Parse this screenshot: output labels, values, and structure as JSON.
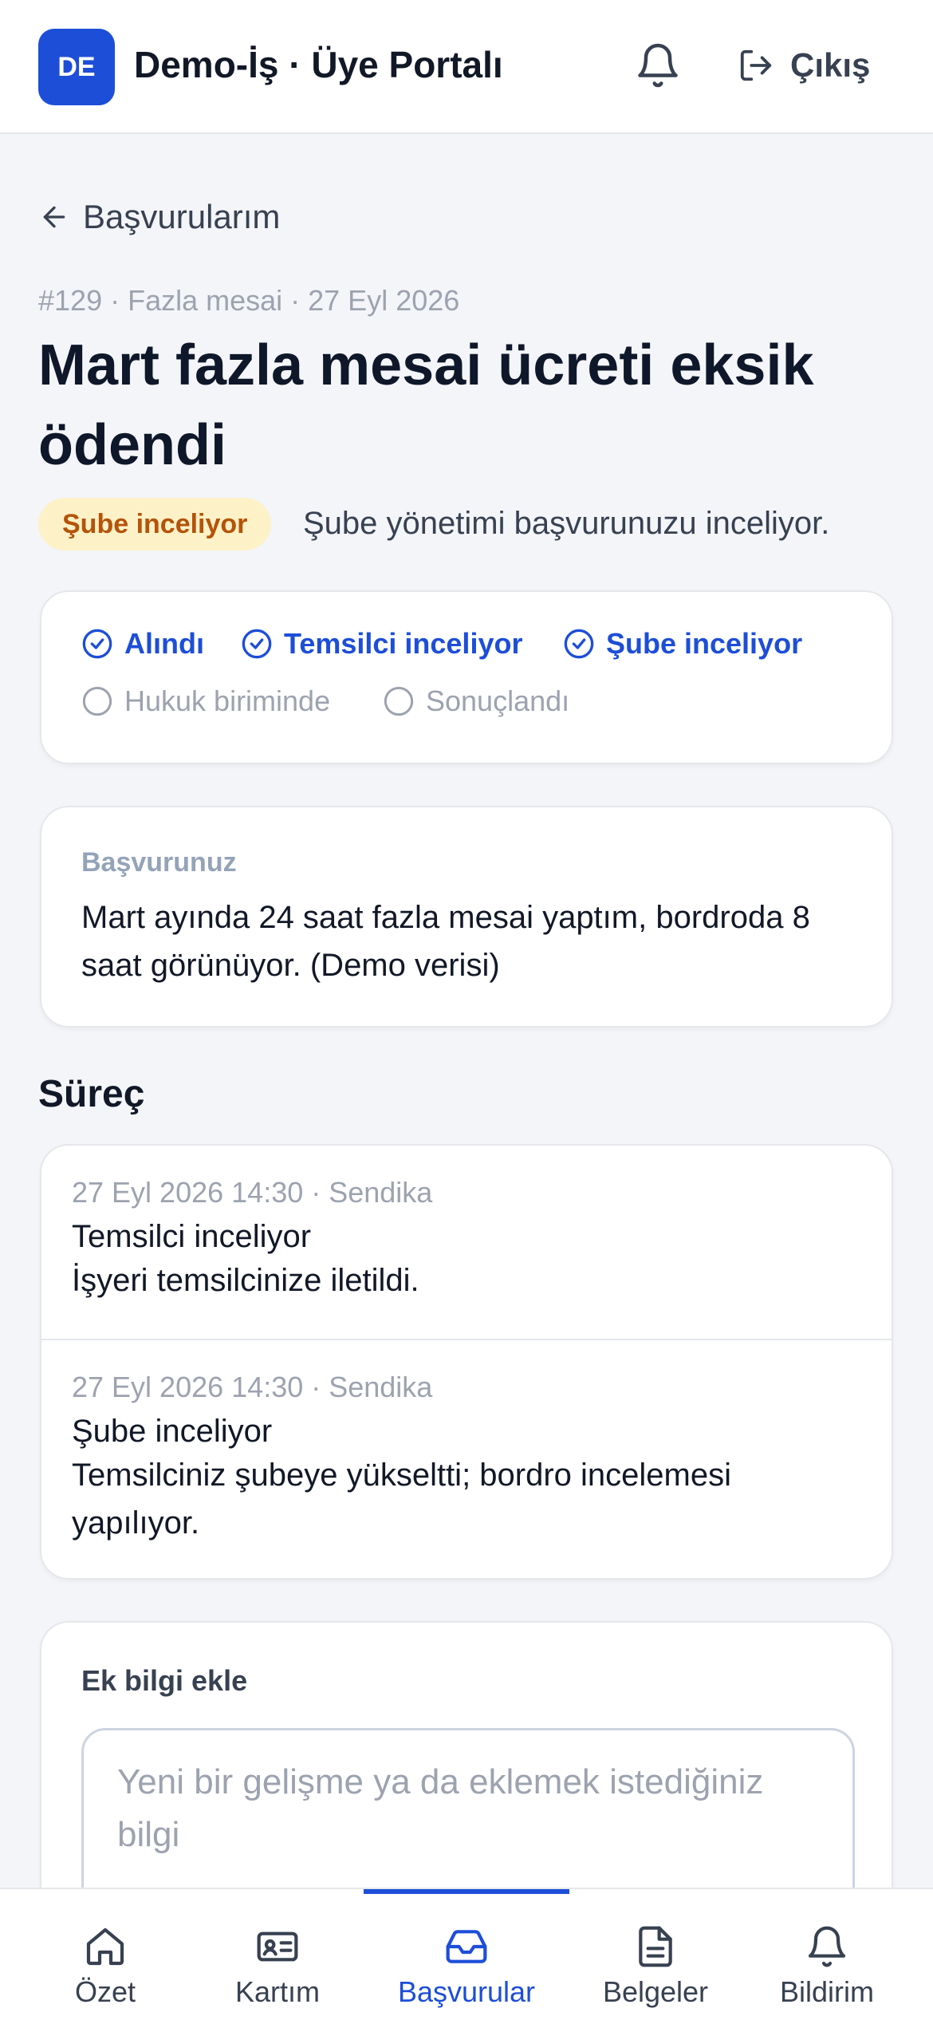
{
  "header": {
    "logo_initials": "DE",
    "app_title": "Demo-İş · Üye Portalı",
    "logout_label": "Çıkış"
  },
  "back_link": "Başvurularım",
  "application": {
    "meta": "#129 · Fazla mesai · 27 Eyl 2026",
    "title": "Mart fazla mesai ücreti eksik ödendi",
    "status_badge": "Şube inceliyor",
    "status_text": "Şube yönetimi başvurunuzu inceliyor.",
    "accent_color": "#1d4ed8",
    "badge_color": "#fdf1c7"
  },
  "steps": [
    {
      "label": "Alındı",
      "done": true
    },
    {
      "label": "Temsilci inceliyor",
      "done": true
    },
    {
      "label": "Şube inceliyor",
      "done": true
    },
    {
      "label": "Hukuk biriminde",
      "done": false
    },
    {
      "label": "Sonuçlandı",
      "done": false
    }
  ],
  "application_card": {
    "label": "Başvurunuz",
    "body": "Mart ayında 24 saat fazla mesai yaptım, bordroda 8 saat görünüyor. (Demo verisi)"
  },
  "process": {
    "title": "Süreç",
    "items": [
      {
        "meta": "27 Eyl 2026 14:30 · Sendika",
        "title": "Temsilci inceliyor",
        "desc": "İşyeri temsilcinize iletildi."
      },
      {
        "meta": "27 Eyl 2026 14:30 · Sendika",
        "title": "Şube inceliyor",
        "desc": "Temsilciniz şubeye yükseltti; bordro incelemesi yapılıyor."
      }
    ]
  },
  "add_info": {
    "label": "Ek bilgi ekle",
    "placeholder": "Yeni bir gelişme ya da eklemek istediğiniz bilgi"
  },
  "bottom_nav": [
    {
      "label": "Özet",
      "icon": "home-icon",
      "active": false
    },
    {
      "label": "Kartım",
      "icon": "id-card-icon",
      "active": false
    },
    {
      "label": "Başvurular",
      "icon": "inbox-icon",
      "active": true
    },
    {
      "label": "Belgeler",
      "icon": "document-icon",
      "active": false
    },
    {
      "label": "Bildirim",
      "icon": "bell-icon",
      "active": false
    }
  ]
}
